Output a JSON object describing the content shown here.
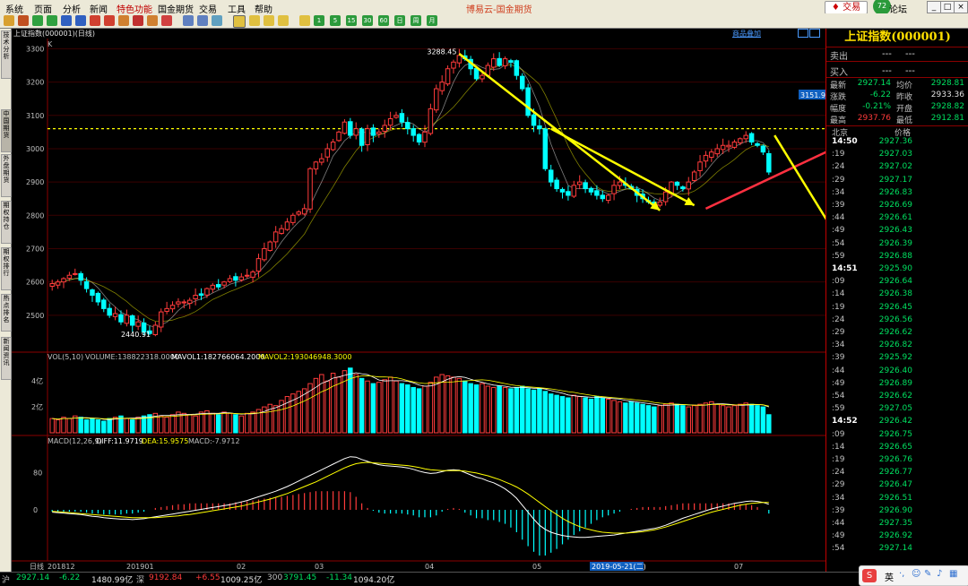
{
  "menu": {
    "items": [
      "系统",
      "页面",
      "分析",
      "新闻",
      "特色功能",
      "国金期货",
      "交易",
      "工具",
      "帮助"
    ],
    "app_title": "博易云-国金期货",
    "trade_button": "交易",
    "forum_badge": "72",
    "forum_label": "论坛"
  },
  "toolbar": {
    "period_buttons": [
      "1",
      "5",
      "15",
      "30",
      "60",
      "日",
      "周",
      "月"
    ]
  },
  "left_tabs": [
    "技术分析",
    "中国期货",
    "外盘期货",
    "期权持仓",
    "期权排行",
    "热点排名",
    "新闻资讯"
  ],
  "chart": {
    "title": "上证指数(000001)(日线)",
    "k_label": "K",
    "overlay_button": "商品叠加",
    "vol_header": {
      "label": "VOL(5,10)",
      "volume": "VOLUME:138822318.0000",
      "mavol1": "MAVOL1:182766064.2000",
      "mavol2": "MAVOL2:193046948.3000"
    },
    "macd_header": {
      "label": "MACD(12,26,9)",
      "diff": "DIFF:11.9719",
      "dea": "DEA:15.9575",
      "macd": "MACD:-7.9712"
    },
    "annotations": {
      "high": "3288.45",
      "low": "2440.91",
      "current_price_tag": "3151.95",
      "cursor_date": "2019-05-21(二)"
    },
    "bottom_label": "日线",
    "colors": {
      "up": "#ff3b3b",
      "down": "#00ffff",
      "ma_white": "#ffffff",
      "ma_yellow": "#ffff00",
      "dashed_line": "#ffff00",
      "arrow_yellow": "#ffff00",
      "arrow_red": "#ff3040"
    }
  },
  "chart_data": {
    "type": "candlestick",
    "price_axis": {
      "ylim": [
        2400,
        3320
      ],
      "ticks": [
        "3300",
        "3200",
        "3100",
        "3000",
        "2900",
        "2800",
        "2700",
        "2600",
        "2500"
      ]
    },
    "volume_axis": {
      "ticks": [
        "4亿",
        "2亿"
      ]
    },
    "macd_axis": {
      "ticks": [
        "80",
        "0"
      ]
    },
    "x_labels": [
      "201812",
      "201901",
      "02",
      "03",
      "04",
      "05",
      "07"
    ],
    "reference_line": 3060,
    "close_path": [
      2595,
      2600,
      2610,
      2620,
      2625,
      2605,
      2580,
      2560,
      2540,
      2520,
      2500,
      2505,
      2480,
      2500,
      2470,
      2480,
      2450,
      2445,
      2470,
      2510,
      2520,
      2530,
      2540,
      2540,
      2545,
      2560,
      2560,
      2580,
      2590,
      2585,
      2600,
      2610,
      2605,
      2615,
      2620,
      2630,
      2670,
      2700,
      2720,
      2750,
      2760,
      2780,
      2800,
      2810,
      2820,
      2940,
      2960,
      2970,
      3000,
      3020,
      3050,
      3080,
      3040,
      3060,
      3010,
      3060,
      3040,
      3050,
      3070,
      3090,
      3100,
      3080,
      3060,
      3040,
      3020,
      3050,
      3120,
      3180,
      3200,
      3240,
      3260,
      3280,
      3270,
      3240,
      3210,
      3220,
      3250,
      3270,
      3250,
      3270,
      3260,
      3220,
      3180,
      3100,
      3070,
      3060,
      2940,
      2900,
      2880,
      2870,
      2860,
      2890,
      2900,
      2880,
      2870,
      2860,
      2850,
      2860,
      2890,
      2900,
      2890,
      2880,
      2860,
      2850,
      2840,
      2830,
      2840,
      2870,
      2900,
      2890,
      2880,
      2900,
      2930,
      2960,
      2980,
      2990,
      3000,
      3010,
      3010,
      3020,
      3030,
      3040,
      3020,
      3010,
      2990,
      2930
    ],
    "volume": [
      1.1,
      1.0,
      1.2,
      1.1,
      1.3,
      1.2,
      1.0,
      1.1,
      1.0,
      0.9,
      1.1,
      1.2,
      1.3,
      1.1,
      1.0,
      1.2,
      1.3,
      1.4,
      1.5,
      1.3,
      1.2,
      1.4,
      1.6,
      1.5,
      1.4,
      1.3,
      1.6,
      1.7,
      1.5,
      1.4,
      1.6,
      1.5,
      1.4,
      1.3,
      1.5,
      1.6,
      1.8,
      2.0,
      2.2,
      2.1,
      2.5,
      2.8,
      3.0,
      3.2,
      3.4,
      3.8,
      4.2,
      4.5,
      4.0,
      4.6,
      4.3,
      4.8,
      5.0,
      4.5,
      4.2,
      4.0,
      3.8,
      3.9,
      4.1,
      4.3,
      4.0,
      3.8,
      3.7,
      3.5,
      3.4,
      3.6,
      3.9,
      4.3,
      4.5,
      4.4,
      4.3,
      4.2,
      4.0,
      3.8,
      3.7,
      3.8,
      3.6,
      3.5,
      3.6,
      3.5,
      3.4,
      3.5,
      3.6,
      3.4,
      3.3,
      3.4,
      3.2,
      3.0,
      2.9,
      2.8,
      2.7,
      2.9,
      2.8,
      2.7,
      2.6,
      2.8,
      2.7,
      2.6,
      2.5,
      2.4,
      2.3,
      2.4,
      2.3,
      2.2,
      2.1,
      2.0,
      2.1,
      2.2,
      2.3,
      2.2,
      2.1,
      2.0,
      2.1,
      2.2,
      2.3,
      2.4,
      2.2,
      2.1,
      2.0,
      2.1,
      2.2,
      2.3,
      2.2,
      2.1,
      2.0,
      1.4
    ],
    "macd_diff": [
      -5,
      -6,
      -7,
      -8,
      -9,
      -10,
      -12,
      -14,
      -15,
      -17,
      -18,
      -19,
      -20,
      -20,
      -21,
      -20,
      -19,
      -17,
      -15,
      -13,
      -11,
      -9,
      -7,
      -5,
      -3,
      -1,
      1,
      3,
      5,
      7,
      9,
      11,
      14,
      17,
      20,
      24,
      28,
      32,
      36,
      40,
      45,
      50,
      56,
      62,
      68,
      74,
      80,
      86,
      92,
      98,
      104,
      110,
      114,
      113,
      108,
      104,
      100,
      97,
      95,
      94,
      93,
      92,
      90,
      87,
      83,
      80,
      78,
      79,
      82,
      85,
      86,
      85,
      80,
      75,
      70,
      67,
      62,
      58,
      52,
      45,
      36,
      25,
      10,
      -5,
      -20,
      -33,
      -42,
      -48,
      -52,
      -55,
      -57,
      -58,
      -59,
      -59,
      -58,
      -57,
      -56,
      -55,
      -54,
      -52,
      -50,
      -48,
      -46,
      -44,
      -42,
      -40,
      -37,
      -33,
      -28,
      -23,
      -18,
      -14,
      -10,
      -6,
      -2,
      2,
      5,
      8,
      11,
      14,
      16,
      18,
      19,
      18,
      16,
      12
    ],
    "macd_dea": [
      -3,
      -4,
      -5,
      -6,
      -7,
      -8,
      -9,
      -10,
      -11,
      -12,
      -13,
      -14,
      -15,
      -16,
      -17,
      -17,
      -17,
      -17,
      -17,
      -16,
      -15,
      -14,
      -13,
      -11,
      -10,
      -8,
      -6,
      -4,
      -2,
      0,
      2,
      4,
      6,
      8,
      11,
      14,
      17,
      20,
      23,
      27,
      31,
      35,
      40,
      45,
      50,
      55,
      60,
      66,
      72,
      78,
      84,
      90,
      95,
      99,
      101,
      102,
      101,
      100,
      99,
      98,
      97,
      96,
      95,
      93,
      91,
      88,
      86,
      85,
      84,
      84,
      84,
      84,
      83,
      81,
      79,
      76,
      73,
      69,
      65,
      60,
      55,
      49,
      42,
      34,
      25,
      16,
      7,
      -2,
      -10,
      -18,
      -25,
      -31,
      -36,
      -40,
      -43,
      -46,
      -48,
      -49,
      -50,
      -50,
      -50,
      -49,
      -48,
      -47,
      -45,
      -43,
      -40,
      -37,
      -33,
      -29,
      -25,
      -21,
      -17,
      -13,
      -9,
      -5,
      -2,
      1,
      4,
      7,
      10,
      12,
      14,
      15,
      16,
      16
    ],
    "trend_arrows": [
      {
        "color": "yellow",
        "from": [
          71,
          3285
        ],
        "to": [
          106,
          2815
        ]
      },
      {
        "color": "yellow",
        "from": [
          87,
          3060
        ],
        "to": [
          112,
          2830
        ]
      },
      {
        "color": "red",
        "from": [
          114,
          2820
        ],
        "to": [
          126,
          3045
        ]
      },
      {
        "color": "yellow",
        "from": [
          126,
          3040
        ],
        "to": [
          146,
          2600
        ]
      }
    ]
  },
  "right_panel": {
    "title": "上证指数(000001)",
    "sell_label": "卖出",
    "sell_values": [
      "---",
      "---"
    ],
    "buy_label": "买入",
    "buy_values": [
      "---",
      "---"
    ],
    "quotes": [
      {
        "l1": "最新",
        "v1": "2927.14",
        "c1": "#00e060",
        "l2": "均价",
        "v2": "2928.81",
        "c2": "#00e060"
      },
      {
        "l1": "涨跌",
        "v1": "-6.22",
        "c1": "#00e060",
        "l2": "昨收",
        "v2": "2933.36",
        "c2": "#e0e0e0"
      },
      {
        "l1": "幅度",
        "v1": "-0.21%",
        "c1": "#00e060",
        "l2": "开盘",
        "v2": "2928.82",
        "c2": "#00e060"
      },
      {
        "l1": "最高",
        "v1": "2937.76",
        "c1": "#ff3b3b",
        "l2": "最低",
        "v2": "2912.81",
        "c2": "#00e060"
      }
    ],
    "tick_header_left": "北京",
    "tick_header_right": "价格",
    "ticks": [
      {
        "t": "14:50",
        "p": "2927.36",
        "major": true
      },
      {
        "t": ":19",
        "p": "2927.03"
      },
      {
        "t": ":24",
        "p": "2927.02"
      },
      {
        "t": ":29",
        "p": "2927.17"
      },
      {
        "t": ":34",
        "p": "2926.83"
      },
      {
        "t": ":39",
        "p": "2926.69"
      },
      {
        "t": ":44",
        "p": "2926.61"
      },
      {
        "t": ":49",
        "p": "2926.43"
      },
      {
        "t": ":54",
        "p": "2926.39"
      },
      {
        "t": ":59",
        "p": "2926.88"
      },
      {
        "t": "14:51",
        "p": "2925.90",
        "major": true
      },
      {
        "t": ":09",
        "p": "2926.64"
      },
      {
        "t": ":14",
        "p": "2926.38"
      },
      {
        "t": ":19",
        "p": "2926.45"
      },
      {
        "t": ":24",
        "p": "2926.56"
      },
      {
        "t": ":29",
        "p": "2926.62"
      },
      {
        "t": ":34",
        "p": "2926.82"
      },
      {
        "t": ":39",
        "p": "2925.92"
      },
      {
        "t": ":44",
        "p": "2926.40"
      },
      {
        "t": ":49",
        "p": "2926.89"
      },
      {
        "t": ":54",
        "p": "2926.62"
      },
      {
        "t": ":59",
        "p": "2927.05"
      },
      {
        "t": "14:52",
        "p": "2926.42",
        "major": true
      },
      {
        "t": ":09",
        "p": "2926.75"
      },
      {
        "t": ":14",
        "p": "2926.65"
      },
      {
        "t": ":19",
        "p": "2926.76"
      },
      {
        "t": ":24",
        "p": "2926.77"
      },
      {
        "t": ":29",
        "p": "2926.47"
      },
      {
        "t": ":34",
        "p": "2926.51"
      },
      {
        "t": ":39",
        "p": "2926.90"
      },
      {
        "t": ":44",
        "p": "2927.35"
      },
      {
        "t": ":49",
        "p": "2926.92"
      },
      {
        "t": ":54",
        "p": "2927.14"
      }
    ]
  },
  "status_bar": {
    "items": [
      {
        "label": "沪",
        "value": "2927.14",
        "change": "-6.22",
        "amount": "1480.99亿"
      },
      {
        "label": "深",
        "value": "9192.84",
        "change": "+6.55",
        "amount": "1009.25亿"
      },
      {
        "label": "300",
        "value": "3791.45",
        "change": "-11.34",
        "amount": "1094.20亿"
      }
    ],
    "ime_label": "英"
  }
}
